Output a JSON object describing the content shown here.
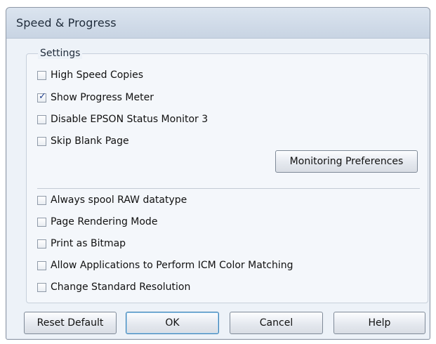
{
  "window": {
    "title": "Speed & Progress"
  },
  "settings_group": {
    "label": "Settings"
  },
  "options_top": [
    {
      "label": "High Speed Copies",
      "checked": false
    },
    {
      "label": "Show Progress Meter",
      "checked": true
    },
    {
      "label": "Disable EPSON Status Monitor 3",
      "checked": false
    },
    {
      "label": "Skip Blank Page",
      "checked": false
    }
  ],
  "options_bottom": [
    {
      "label": "Always spool RAW datatype",
      "checked": false
    },
    {
      "label": "Page Rendering Mode",
      "checked": false
    },
    {
      "label": "Print as Bitmap",
      "checked": false
    },
    {
      "label": "Allow Applications to Perform ICM Color Matching",
      "checked": false
    },
    {
      "label": "Change Standard Resolution",
      "checked": false
    }
  ],
  "buttons": {
    "monitoring_preferences": "Monitoring Preferences",
    "reset_default": "Reset Default",
    "ok": "OK",
    "cancel": "Cancel",
    "help": "Help"
  },
  "colors": {
    "check_mark": "#1e3e8c",
    "window_bg": "#edf2f8"
  }
}
